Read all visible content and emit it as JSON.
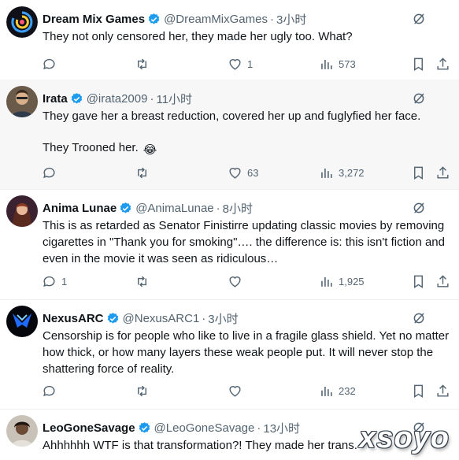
{
  "tweets": [
    {
      "name": "Dream Mix Games",
      "handle": "@DreamMixGames",
      "dot": "·",
      "time": "3小时",
      "lines": [
        "They not only censored her, they made her ugly too. What?"
      ],
      "reply_count": "",
      "like_count": "1",
      "view_count": "573",
      "avatar_icon": "swirl-logo-avatar"
    },
    {
      "name": "Irata",
      "handle": "@irata2009",
      "dot": "·",
      "time": "11小时",
      "lines": [
        "They gave her a breast reduction, covered her up and fuglyfied her face.",
        "They Trooned her."
      ],
      "emoji": "😂",
      "reply_count": "",
      "like_count": "63",
      "view_count": "3,272",
      "avatar_icon": "person-photo-avatar"
    },
    {
      "name": "Anima Lunae",
      "handle": "@AnimaLunae",
      "dot": "·",
      "time": "8小时",
      "lines": [
        "This is as retarded as Senator Finistirre updating classic movies by removing cigarettes in \"Thank you for smoking\"…. the difference is: this isn't fiction and even in the movie it was seen as ridiculous…"
      ],
      "reply_count": "1",
      "like_count": "",
      "view_count": "1,925",
      "avatar_icon": "character-avatar"
    },
    {
      "name": "NexusARC",
      "handle": "@NexusARC1",
      "dot": "·",
      "time": "3小时",
      "lines": [
        "Censorship is for people who like to live in a fragile glass shield. Yet no matter how thick, or how many layers these weak people put. It will never stop the shattering force of reality."
      ],
      "reply_count": "",
      "like_count": "",
      "view_count": "232",
      "avatar_icon": "blue-logo-avatar"
    },
    {
      "name": "LeoGoneSavage",
      "handle": "@LeoGoneSavage",
      "dot": "·",
      "time": "13小时",
      "lines": [
        "Ahhhhhh WTF is that transformation?! They made her trans."
      ],
      "avatar_icon": "person-photo-avatar"
    }
  ],
  "watermark": "xsoyo",
  "colors": {
    "verified": "#1d9bf0",
    "muted": "#536471",
    "text": "#0f1419"
  }
}
